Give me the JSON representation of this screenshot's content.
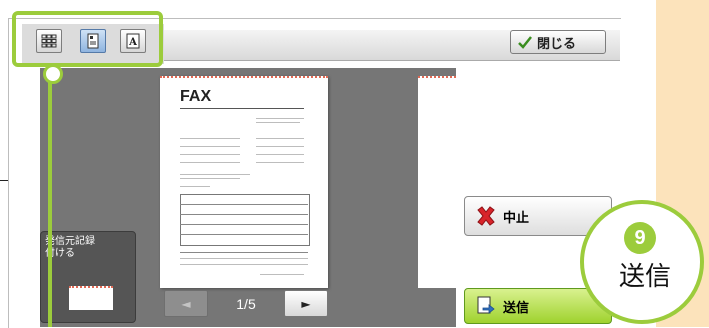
{
  "close_label": "閉じる",
  "view_modes": [
    {
      "name": "thumbnail-grid",
      "icon": "grid-icon"
    },
    {
      "name": "page-view",
      "icon": "page-icon",
      "active": true
    },
    {
      "name": "enlarged-text",
      "icon": "text-a-icon"
    }
  ],
  "preview": {
    "doc_title": "FAX",
    "page_indicator": "1/5",
    "prev_icon": "◄",
    "next_icon": "►"
  },
  "origin_panel": {
    "label": "発信元記録\n付ける"
  },
  "buttons": {
    "stop_label": "中止",
    "send_label": "送信"
  },
  "callout": {
    "step_number": "9",
    "step_label": "送信",
    "highlight_color": "#9ccc3c"
  },
  "colors": {
    "side_band": "#fce3bb",
    "preview_bg": "#767676",
    "send_button": "#9fd22e"
  }
}
